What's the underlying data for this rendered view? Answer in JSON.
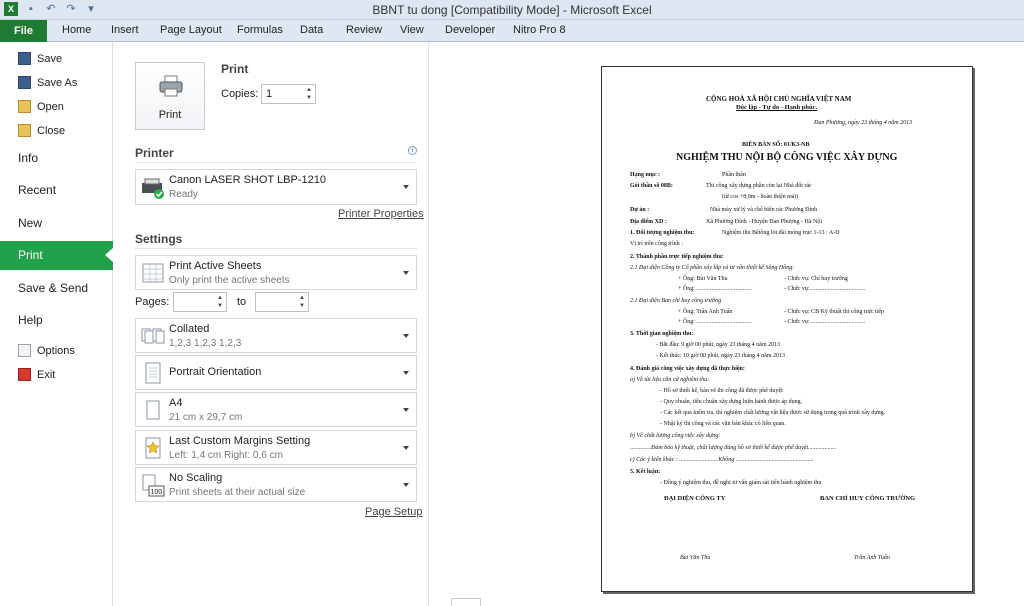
{
  "window": {
    "title": "BBNT tu dong  [Compatibility Mode]  -  Microsoft Excel"
  },
  "ribbon": {
    "file": "File",
    "tabs": [
      "Home",
      "Insert",
      "Page Layout",
      "Formulas",
      "Data",
      "Review",
      "View",
      "Developer",
      "Nitro Pro 8"
    ]
  },
  "nav": {
    "save": "Save",
    "save_as": "Save As",
    "open": "Open",
    "close": "Close",
    "info": "Info",
    "recent": "Recent",
    "new": "New",
    "print": "Print",
    "save_send": "Save & Send",
    "help": "Help",
    "options": "Options",
    "exit": "Exit"
  },
  "print": {
    "button": "Print",
    "heading": "Print",
    "copies_label": "Copies:",
    "copies_value": "1"
  },
  "printer": {
    "heading": "Printer",
    "name": "Canon LASER SHOT LBP-1210",
    "status": "Ready",
    "properties_link": "Printer Properties"
  },
  "settings": {
    "heading": "Settings",
    "what": {
      "title": "Print Active Sheets",
      "sub": "Only print the active sheets"
    },
    "pages_label": "Pages:",
    "to_label": "to",
    "collate": {
      "title": "Collated",
      "sub": "1,2,3    1,2,3    1,2,3"
    },
    "orientation": {
      "title": "Portrait Orientation"
    },
    "paper": {
      "title": "A4",
      "sub": "21 cm x 29,7 cm"
    },
    "margins": {
      "title": "Last Custom Margins Setting",
      "sub": "Left:  1,4 cm    Right:  0,6 cm"
    },
    "scaling": {
      "title": "No Scaling",
      "sub": "Print sheets at their actual size"
    },
    "page_setup_link": "Page Setup"
  },
  "document": {
    "header1": "CỘNG HOÀ XÃ HỘI CHỦ NGHĨA VIỆT NAM",
    "header2": "Độc lập - Tự do - Hạnh phúc.",
    "date": "Đan Phượng, ngày 23 tháng 4 năm 2013",
    "number": "BIÊN BẢN SỐ: 01/K3-NB",
    "title": "NGHIỆM THU NỘI BỘ CÔNG VIỆC XÂY DỰNG",
    "hang_muc_label": "Hạng mục :",
    "hang_muc_value": "Phần thân",
    "goi_thau_label": "Gói thầu số 08B:",
    "goi_thau_value": "Thi công xây dựng phần còn lại Nhà đốt rác",
    "goi_thau_sub": "(từ cos +8,0m - hoàn thiện mái)",
    "du_an_label": "Dự án :",
    "du_an_value": "Nhà máy xử lý và chế biến rác Phương Đình",
    "dia_diem_label": "Địa điểm XD :",
    "dia_diem_value": "Xã Phương Đình - Huyện Đan Phượng - Hà Nội",
    "s1": "1. Đối tượng nghiệm thu:",
    "s1_value": "Nghiệm thu Bêtông lót đài móng trục 1-13 : A-D",
    "s1_sub": "Vị trí trên công trình :",
    "s2": "2. Thành phần trực tiếp nghiệm thu:",
    "s21": "2.1 Đại diện Công ty Cổ phần xây lắp và tư vấn thiết kế Sông Hồng:",
    "s21_r1a": "+ Ông:   Bùi Văn Thu",
    "s21_r1b": "- Chức vụ: Chỉ huy trưởng",
    "s21_r2a": "+ Ông: .....................................",
    "s21_r2b": "- Chức vụ:.....................................",
    "s22": "2.1 Đại diện Ban chỉ huy công trường",
    "s22_r1a": "+ Ông:   Trần Anh Tuấn",
    "s22_r1b": "- Chức vụ: CB Kỹ thuật thi công trực tiếp",
    "s22_r2a": "+ Ông: .....................................",
    "s22_r2b": "- Chức vụ:.....................................",
    "s3": "3. Thời gian nghiệm thu:",
    "s3_start": "- Bắt đầu:    9 giờ 00 phút, ngày 23 tháng 4 năm 2013",
    "s3_end": "- Kết thúc:   10 giờ 00 phút, ngày 23 tháng 4 năm 2013",
    "s4": "4. Đánh giá công việc xây dựng đã thực hiện:",
    "s4a": "a) Về tài liệu căn cứ nghiệm thu:",
    "s4a1": "- Hồ sơ thiết kế, bản vẽ thi công đã được phê duyệt",
    "s4a2": "- Quy chuẩn, tiêu chuẩn xây dựng hiện hành được áp dụng.",
    "s4a3": "- Các kết quả kiểm tra, thí nghiệm chất lượng vật liệu được sử dụng trong quá trình xây dựng.",
    "s4a4": "- Nhật ký thi công và các văn bản khác có liên quan.",
    "s4b": "b) Về chất lượng công việc xây dựng:",
    "s4b1": "..............Đảm bảo kỹ thuật, chất lượng đúng hồ sơ thiết kế được phê duyệt...................",
    "s4c": "c) Các ý kiến khác :  ..........................Không ....................................................",
    "s5": "5. Kết luận:",
    "s5_1": "- Đồng ý nghiệm thu, đề nghị tư vấn giám sát tiến hành nghiệm thu",
    "sign_left": "ĐẠI DIỆN CÔNG TY",
    "sign_right": "BAN CHỈ HUY CÔNG TRƯỜNG",
    "name_left": "Bùi Văn Thu",
    "name_right": "Trần Anh Tuấn"
  },
  "colors": {
    "accent": "#22a04b",
    "file_tab": "#1f7a34"
  }
}
